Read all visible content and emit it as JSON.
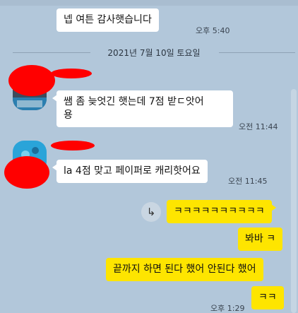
{
  "messages": {
    "m0": {
      "text": "넵 여튼 감사햇습니다",
      "time": "오후 5:40"
    },
    "date_divider": "2021년 7월 10일 토요일",
    "m1": {
      "line1": "쌤 좀 늦엇긴 햇는데 7점 받ㄷ앗어",
      "line2": "용",
      "time": "오전 11:44"
    },
    "m2": {
      "text": "la 4점 맞고 페이퍼로 캐리핫어요",
      "time": "오전 11:45"
    },
    "m3": {
      "text": "ㅋㅋㅋㅋㅋㅋㅋㅋㅋㅋ"
    },
    "m4": {
      "text": "봐바 ㅋ"
    },
    "m5": {
      "text": "끝까지 하면 된다 했어 안된다 했어"
    },
    "m6": {
      "text": "ㅋㅋ",
      "time": "오후 1:29"
    }
  },
  "icons": {
    "share": "share-arrow-icon"
  },
  "colors": {
    "background": "#b2c7da",
    "incoming": "#ffffff",
    "outgoing": "#fee500",
    "redaction": "#ff0000"
  }
}
